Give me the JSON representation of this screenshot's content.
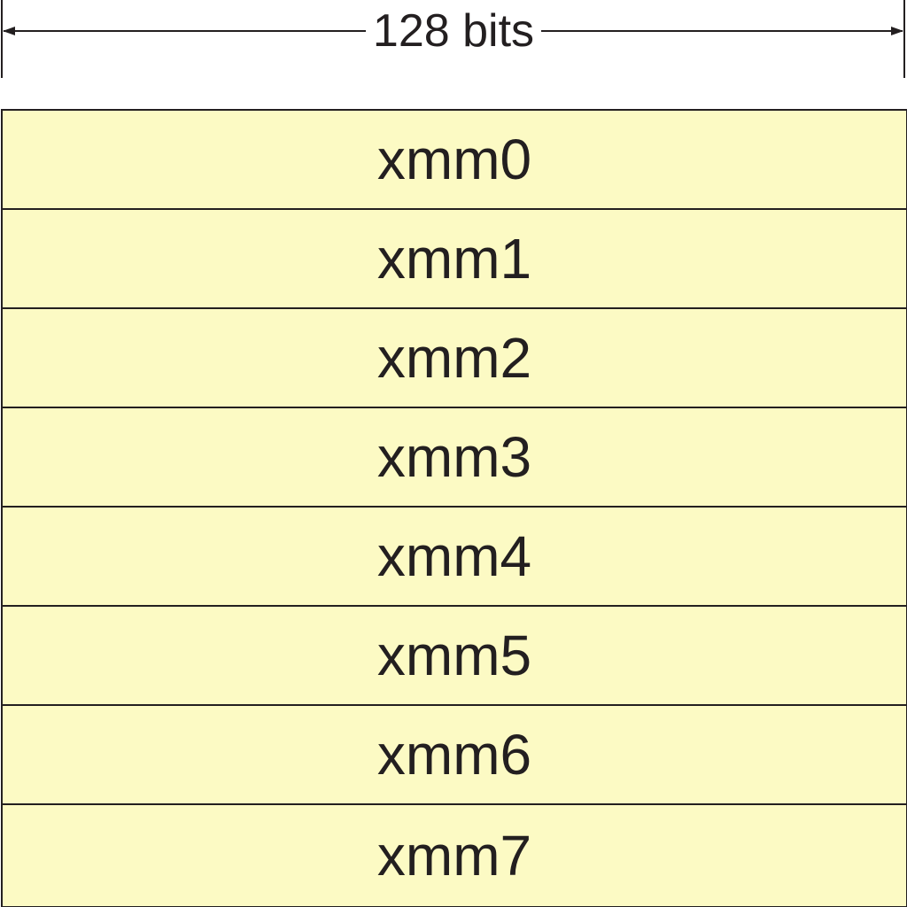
{
  "width_indicator": {
    "label": "128 bits"
  },
  "registers": [
    {
      "name": "xmm0"
    },
    {
      "name": "xmm1"
    },
    {
      "name": "xmm2"
    },
    {
      "name": "xmm3"
    },
    {
      "name": "xmm4"
    },
    {
      "name": "xmm5"
    },
    {
      "name": "xmm6"
    },
    {
      "name": "xmm7"
    }
  ],
  "colors": {
    "register_fill": "#fcfac4",
    "line": "#231f20",
    "background": "#ffffff"
  }
}
